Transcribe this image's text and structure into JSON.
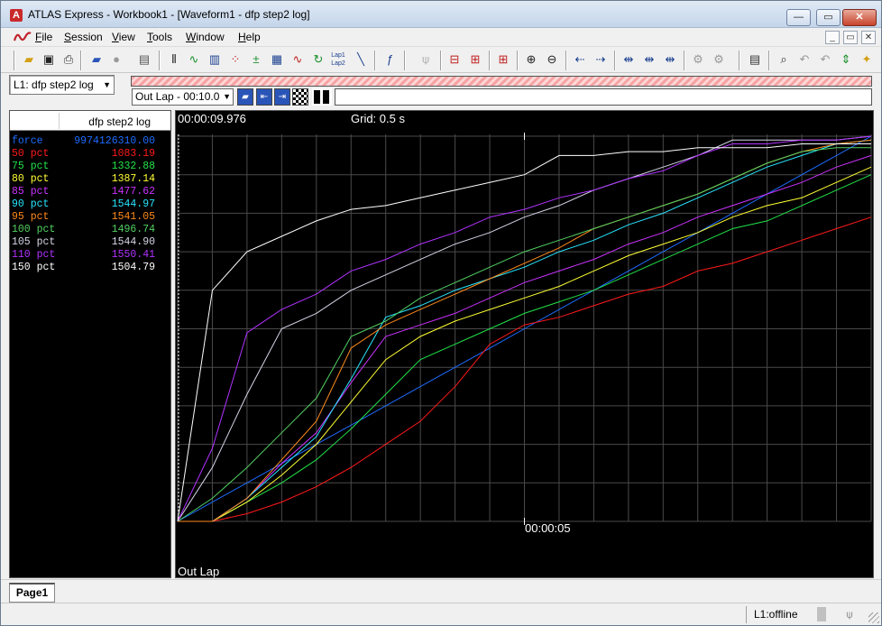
{
  "window": {
    "app_icon_letter": "A",
    "title": "ATLAS Express - Workbook1 - [Waveform1 - dfp step2 log]",
    "min_glyph": "—",
    "max_glyph": "▭",
    "close_glyph": "✕"
  },
  "menu": {
    "logo_icon": "atlas-wave-icon",
    "items": [
      "File",
      "Session",
      "View",
      "Tools",
      "Window",
      "Help"
    ],
    "mdi": [
      "_",
      "▭",
      "✕"
    ]
  },
  "toolbar": {
    "icons": [
      "open-folder-icon",
      "save-icon",
      "print-icon",
      "open-session-icon",
      "record-icon",
      "page-setup-icon",
      "vertical-bars-icon",
      "waveform-icon",
      "histogram-icon",
      "scatter-icon",
      "math-icon",
      "colormap-icon",
      "sine-wave-icon",
      "lap-cycle-icon",
      "lap-compare-icon",
      "diagonal-line-icon",
      "function-icon",
      "antenna-icon",
      "split-horizontal-icon",
      "split-vertical-icon",
      "grid-cursor-icon",
      "zoom-in-icon",
      "zoom-out-icon",
      "pan-left-icon",
      "pan-right-icon",
      "align-left-icon",
      "align-center-icon",
      "align-right-icon",
      "gear-icon",
      "gear-plus-icon",
      "properties-icon",
      "zoom-reset-icon",
      "undo-icon",
      "redo-icon",
      "fit-icon",
      "lightbulb-icon"
    ],
    "lap_toolbar_text": "Lap1 Lap2"
  },
  "session": {
    "selected": "L1: dfp step2 log",
    "lap_selected": "Out Lap - 00:10.0"
  },
  "values_panel": {
    "header": "dfp step2 log",
    "rows": [
      {
        "name": "force",
        "value": "9974126310.00",
        "color": "#1e6cff"
      },
      {
        "name": "50 pct",
        "value": "1083.19",
        "color": "#ff1a1a"
      },
      {
        "name": "75 pct",
        "value": "1332.88",
        "color": "#22e24a"
      },
      {
        "name": "80 pct",
        "value": "1387.14",
        "color": "#ffff33"
      },
      {
        "name": "85 pct",
        "value": "1477.62",
        "color": "#cc33ff"
      },
      {
        "name": "90 pct",
        "value": "1544.97",
        "color": "#28e6ff"
      },
      {
        "name": "95 pct",
        "value": "1541.05",
        "color": "#ff8a1a"
      },
      {
        "name": "100 pct",
        "value": "1496.74",
        "color": "#52d162"
      },
      {
        "name": "105 pct",
        "value": "1544.90",
        "color": "#d6d6e8"
      },
      {
        "name": "110 pct",
        "value": "1550.41",
        "color": "#b133ff"
      },
      {
        "name": "150 pct",
        "value": "1504.79",
        "color": "#ffffff"
      }
    ]
  },
  "plot": {
    "cursor_time": "00:00:09.976",
    "grid_label": "Grid: 0.5 s",
    "x_tick_label": "00:00:05",
    "lap_label": "Out Lap"
  },
  "chart_data": {
    "type": "line",
    "xlabel": "",
    "ylabel": "",
    "x_unit": "s",
    "xlim": [
      0,
      10
    ],
    "ylim": [
      0,
      1
    ],
    "grid": true,
    "x": [
      0,
      0.5,
      1,
      1.5,
      2,
      2.5,
      3,
      3.5,
      4,
      4.5,
      5,
      5.5,
      6,
      6.5,
      7,
      7.5,
      8,
      8.5,
      9,
      9.5,
      10
    ],
    "series": [
      {
        "name": "force",
        "color": "#1e6cff",
        "values": [
          0,
          0.05,
          0.1,
          0.15,
          0.2,
          0.25,
          0.3,
          0.35,
          0.4,
          0.45,
          0.5,
          0.55,
          0.6,
          0.65,
          0.7,
          0.75,
          0.8,
          0.85,
          0.9,
          0.95,
          1.0
        ]
      },
      {
        "name": "50 pct",
        "color": "#ff1a1a",
        "values": [
          0,
          0,
          0.02,
          0.05,
          0.09,
          0.14,
          0.2,
          0.26,
          0.35,
          0.46,
          0.51,
          0.53,
          0.56,
          0.59,
          0.61,
          0.65,
          0.67,
          0.7,
          0.73,
          0.76,
          0.79
        ]
      },
      {
        "name": "75 pct",
        "color": "#22e24a",
        "values": [
          0,
          0,
          0.05,
          0.1,
          0.16,
          0.24,
          0.33,
          0.42,
          0.46,
          0.5,
          0.54,
          0.57,
          0.6,
          0.64,
          0.68,
          0.72,
          0.76,
          0.78,
          0.82,
          0.86,
          0.9
        ]
      },
      {
        "name": "80 pct",
        "color": "#ffff33",
        "values": [
          0,
          0,
          0.05,
          0.12,
          0.2,
          0.31,
          0.42,
          0.48,
          0.52,
          0.55,
          0.58,
          0.61,
          0.65,
          0.69,
          0.72,
          0.75,
          0.79,
          0.82,
          0.84,
          0.88,
          0.92
        ]
      },
      {
        "name": "85 pct",
        "color": "#cc33ff",
        "values": [
          0,
          0,
          0.06,
          0.15,
          0.23,
          0.36,
          0.48,
          0.51,
          0.54,
          0.58,
          0.62,
          0.65,
          0.68,
          0.72,
          0.75,
          0.79,
          0.82,
          0.85,
          0.88,
          0.92,
          0.95
        ]
      },
      {
        "name": "90 pct",
        "color": "#28e6ff",
        "values": [
          0,
          0,
          0.06,
          0.14,
          0.22,
          0.37,
          0.53,
          0.56,
          0.6,
          0.63,
          0.66,
          0.7,
          0.73,
          0.77,
          0.8,
          0.84,
          0.88,
          0.92,
          0.95,
          0.98,
          0.99
        ]
      },
      {
        "name": "95 pct",
        "color": "#ff8a1a",
        "values": [
          0,
          0,
          0.06,
          0.16,
          0.26,
          0.45,
          0.51,
          0.55,
          0.59,
          0.63,
          0.67,
          0.71,
          0.76,
          0.79,
          0.82,
          0.85,
          0.89,
          0.93,
          0.96,
          0.98,
          0.99
        ]
      },
      {
        "name": "100 pct",
        "color": "#52d162",
        "values": [
          0,
          0.06,
          0.14,
          0.23,
          0.32,
          0.48,
          0.52,
          0.58,
          0.62,
          0.66,
          0.7,
          0.73,
          0.76,
          0.79,
          0.82,
          0.85,
          0.89,
          0.93,
          0.96,
          0.97,
          0.97
        ]
      },
      {
        "name": "105 pct",
        "color": "#d6d6e8",
        "values": [
          0,
          0.14,
          0.33,
          0.5,
          0.54,
          0.6,
          0.64,
          0.68,
          0.72,
          0.75,
          0.79,
          0.82,
          0.86,
          0.89,
          0.92,
          0.95,
          0.99,
          0.99,
          0.99,
          0.99,
          1.0
        ]
      },
      {
        "name": "110 pct",
        "color": "#b133ff",
        "values": [
          0,
          0.19,
          0.49,
          0.55,
          0.59,
          0.65,
          0.68,
          0.72,
          0.75,
          0.79,
          0.81,
          0.84,
          0.86,
          0.89,
          0.91,
          0.95,
          0.98,
          0.98,
          0.99,
          0.99,
          1.0
        ]
      },
      {
        "name": "150 pct",
        "color": "#ffffff",
        "values": [
          0,
          0.6,
          0.7,
          0.74,
          0.78,
          0.81,
          0.82,
          0.84,
          0.86,
          0.88,
          0.9,
          0.95,
          0.95,
          0.96,
          0.96,
          0.97,
          0.97,
          0.97,
          0.98,
          0.98,
          0.98
        ]
      }
    ]
  }
}
